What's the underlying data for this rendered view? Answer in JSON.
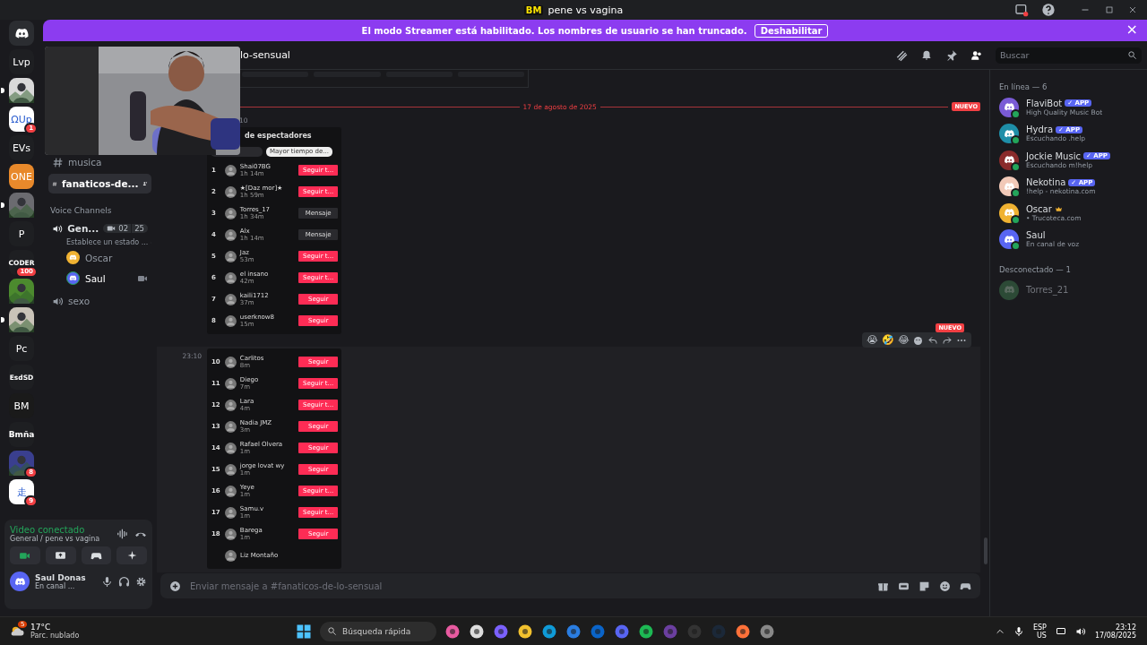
{
  "window": {
    "logo": "BM",
    "title": "pene vs vagina"
  },
  "banner": {
    "text": "El modo Streamer está habilitado. Los nombres de usuario se han truncado.",
    "button": "Deshabilitar",
    "close": "×"
  },
  "servers": [
    {
      "kind": "discord"
    },
    {
      "kind": "text",
      "label": "Lvp",
      "color": "#1e1f22"
    },
    {
      "kind": "picture",
      "color": "#d9d9d9"
    },
    {
      "kind": "text",
      "label": "ΩUp",
      "color": "#ffffff",
      "badge": "1"
    },
    {
      "kind": "text",
      "label": "EVs",
      "color": "#1e1f22"
    },
    {
      "kind": "text",
      "label": "ONE",
      "color": "#e8892b"
    },
    {
      "kind": "picture",
      "color": "#6b6b70"
    },
    {
      "kind": "text",
      "label": "P",
      "color": "#1e1f22"
    },
    {
      "kind": "text",
      "label": "CODER",
      "color": "#1e1f22",
      "badge": "100"
    },
    {
      "kind": "picture",
      "color": "#4c8a2e"
    },
    {
      "kind": "picture",
      "color": "#c9c3b8"
    },
    {
      "kind": "text",
      "label": "Pc",
      "color": "#1e1f22"
    },
    {
      "kind": "text",
      "label": "EsdSD",
      "color": "#1e1f22"
    },
    {
      "kind": "text",
      "label": "BM",
      "color": "#1a1a1a"
    },
    {
      "kind": "text",
      "label": "Bmña",
      "color": "#1e1f22"
    },
    {
      "kind": "picture",
      "color": "#3a3f8f",
      "badge": "8"
    },
    {
      "kind": "text",
      "label": "走",
      "color": "#ffffff",
      "badge": "9"
    }
  ],
  "channels": [
    {
      "kind": "text",
      "name": "musica",
      "selected": false
    },
    {
      "kind": "text",
      "name": "fanaticos-de...",
      "selected": true
    },
    {
      "kind": "category",
      "name": "Voice Channels"
    },
    {
      "kind": "voice",
      "name": "Gen...",
      "video_count": "02",
      "count": "25",
      "status": "Establece un estado ...",
      "users": [
        {
          "name": "Oscar",
          "color": "#f0b232",
          "speaking": false
        },
        {
          "name": "Saul",
          "color": "#5865f2",
          "speaking": true,
          "camera": true
        }
      ]
    },
    {
      "kind": "voice",
      "name": "sexo"
    }
  ],
  "voice_panel": {
    "title": "Video conectado",
    "subtitle": "General / pene vs vagina"
  },
  "user": {
    "name": "Saul Donas",
    "status": "En canal ..."
  },
  "header": {
    "channel": "lo-sensual",
    "search_placeholder": "Buscar"
  },
  "chat": {
    "date_divider": "17 de agosto de 2025",
    "new_badge": "NUEVO",
    "messages": [
      {
        "time": "10",
        "image": {
          "title": "de espectadores",
          "filters": [
            {
              "selected": false
            },
            {
              "label": "Mayor tiempo de...",
              "selected": true
            }
          ],
          "rows": [
            {
              "rank": "1",
              "name": "Shai07BG",
              "time": "1h 14m",
              "kind": "follow",
              "button": "Seguir t..."
            },
            {
              "rank": "2",
              "name": "★[Daz mor]★",
              "time": "1h 59m",
              "kind": "follow",
              "button": "Seguir t..."
            },
            {
              "rank": "3",
              "name": "Torres_17",
              "time": "1h 34m",
              "kind": "message",
              "button": "Mensaje"
            },
            {
              "rank": "4",
              "name": "Alx",
              "time": "1h 14m",
              "kind": "message",
              "button": "Mensaje"
            },
            {
              "rank": "5",
              "name": "Jaz",
              "time": "53m",
              "kind": "follow",
              "button": "Seguir t..."
            },
            {
              "rank": "6",
              "name": "el insano",
              "time": "42m",
              "kind": "follow",
              "button": "Seguir t..."
            },
            {
              "rank": "7",
              "name": "kaili1712",
              "time": "37m",
              "kind": "follow",
              "button": "Seguir"
            },
            {
              "rank": "8",
              "name": "userknow8",
              "time": "15m",
              "kind": "follow",
              "button": "Seguir"
            }
          ]
        }
      },
      {
        "time": "23:10",
        "hovered": true,
        "new_badge": "NUEVO",
        "reactions": [
          "😭",
          "🤣",
          "😂"
        ],
        "image": {
          "rows": [
            {
              "rank": "10",
              "name": "Carlitos",
              "time": "8m",
              "kind": "follow",
              "button": "Seguir"
            },
            {
              "rank": "11",
              "name": "Diego",
              "time": "7m",
              "kind": "follow",
              "button": "Seguir t..."
            },
            {
              "rank": "12",
              "name": "Lara",
              "time": "4m",
              "kind": "follow",
              "button": "Seguir t..."
            },
            {
              "rank": "13",
              "name": "Nadia JMZ",
              "time": "3m",
              "kind": "follow",
              "button": "Seguir"
            },
            {
              "rank": "14",
              "name": "Rafael Olvera",
              "time": "1m",
              "kind": "follow",
              "button": "Seguir"
            },
            {
              "rank": "15",
              "name": "jorge lovat wy",
              "time": "1m",
              "kind": "follow",
              "button": "Seguir"
            },
            {
              "rank": "16",
              "name": "Yeye",
              "time": "1m",
              "kind": "follow",
              "button": "Seguir t..."
            },
            {
              "rank": "17",
              "name": "Samu.v",
              "time": "1m",
              "kind": "follow",
              "button": "Seguir t..."
            },
            {
              "rank": "18",
              "name": "Barega",
              "time": "1m",
              "kind": "follow",
              "button": "Seguir"
            },
            {
              "name": "Liz Montaño"
            }
          ]
        }
      }
    ],
    "composer_placeholder": "Enviar mensaje a #fanaticos-de-lo-sensual"
  },
  "members": {
    "groups": [
      {
        "title": "En línea — 6",
        "items": [
          {
            "name": "FlaviBot",
            "status": "High Quality Music Bot",
            "tag": "✓ APP",
            "owner": false,
            "color": "#7a5bd6",
            "online": true
          },
          {
            "name": "Hydra",
            "status": "Escuchando .help",
            "tag": "✓ APP",
            "owner": false,
            "color": "#1e8ea8",
            "online": true
          },
          {
            "name": "Jockie Music",
            "status": "Escuchando m!help",
            "tag": "✓ APP",
            "owner": false,
            "color": "#8a2b2b",
            "online": true
          },
          {
            "name": "Nekotina",
            "status": "!help - nekotina.com",
            "tag": "✓ APP",
            "owner": false,
            "color": "#f2c9b8",
            "online": true
          },
          {
            "name": "Oscar",
            "status": "• Trucoteca.com",
            "owner": true,
            "color": "#f0b232",
            "online": true
          },
          {
            "name": "Saul",
            "status": "En canal de voz",
            "owner": false,
            "color": "#5865f2",
            "online": true
          }
        ]
      },
      {
        "title": "Desconectado — 1",
        "items": [
          {
            "name": "Torres_21",
            "owner": false,
            "color": "#2c4a36",
            "online": false
          }
        ]
      }
    ]
  },
  "taskbar": {
    "weather_temp": "17°C",
    "weather_text": "Parc. nublado",
    "weather_badge": "5",
    "search_placeholder": "Búsqueda rápida",
    "lang_top": "ESP",
    "lang_bottom": "US",
    "time": "23:12",
    "date": "17/08/2025"
  }
}
